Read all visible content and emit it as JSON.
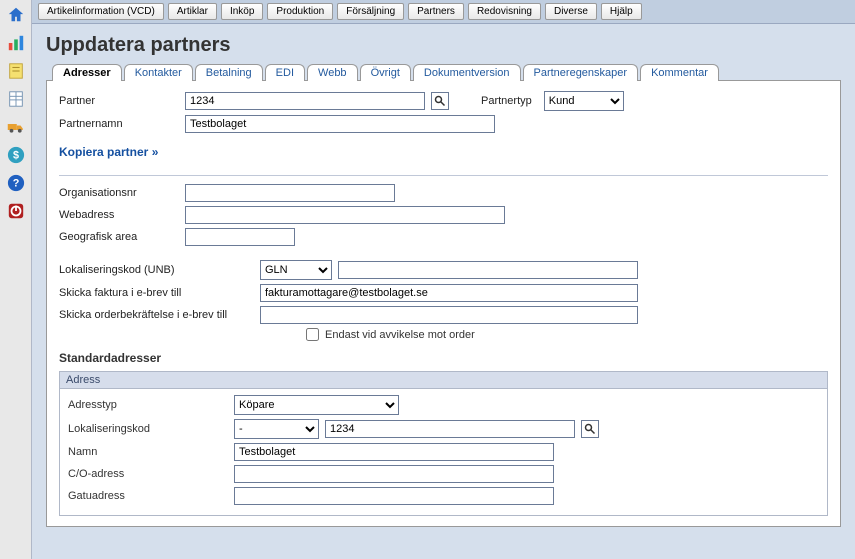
{
  "iconbar": [
    {
      "name": "home-icon",
      "color": "#2B6FCB"
    },
    {
      "name": "chart-icon",
      "color": "#E67E22"
    },
    {
      "name": "note-icon",
      "color": "#E0C020"
    },
    {
      "name": "sheet-icon",
      "color": "#7090B0"
    },
    {
      "name": "truck-icon",
      "color": "#E8A030"
    },
    {
      "name": "dollar-icon",
      "color": "#30A0C0"
    },
    {
      "name": "help-icon",
      "color": "#2060C0"
    },
    {
      "name": "power-icon",
      "color": "#B02020"
    }
  ],
  "topmenu": [
    "Artikelinformation (VCD)",
    "Artiklar",
    "Inköp",
    "Produktion",
    "Försäljning",
    "Partners",
    "Redovisning",
    "Diverse",
    "Hjälp"
  ],
  "page_title": "Uppdatera partners",
  "tabs": [
    "Adresser",
    "Kontakter",
    "Betalning",
    "EDI",
    "Webb",
    "Övrigt",
    "Dokumentversion",
    "Partneregenskaper",
    "Kommentar"
  ],
  "active_tab": 0,
  "form": {
    "partner_label": "Partner",
    "partner_value": "1234",
    "partnertyp_label": "Partnertyp",
    "partnertyp_value": "Kund",
    "partnernamn_label": "Partnernamn",
    "partnernamn_value": "Testbolaget",
    "copy_link": "Kopiera partner »",
    "orgnr_label": "Organisationsnr",
    "orgnr_value": "",
    "web_label": "Webadress",
    "web_value": "",
    "geo_label": "Geografisk area",
    "geo_value": "",
    "lok_label": "Lokaliseringskod (UNB)",
    "lok_type": "GLN",
    "lok_value": "",
    "einv_label": "Skicka faktura i e-brev till",
    "einv_value": "fakturamottagare@testbolaget.se",
    "eord_label": "Skicka orderbekräftelse i e-brev till",
    "eord_value": "",
    "only_dev_label": "Endast vid avvikelse mot order"
  },
  "addresses": {
    "section_title": "Standardadresser",
    "panel_title": "Adress",
    "adresstyp_label": "Adresstyp",
    "adresstyp_value": "Köpare",
    "lok_label": "Lokaliseringskod",
    "lok_type": "-",
    "lok_value": "1234",
    "namn_label": "Namn",
    "namn_value": "Testbolaget",
    "co_label": "C/O-adress",
    "co_value": "",
    "gatu_label": "Gatuadress",
    "gatu_value": ""
  }
}
